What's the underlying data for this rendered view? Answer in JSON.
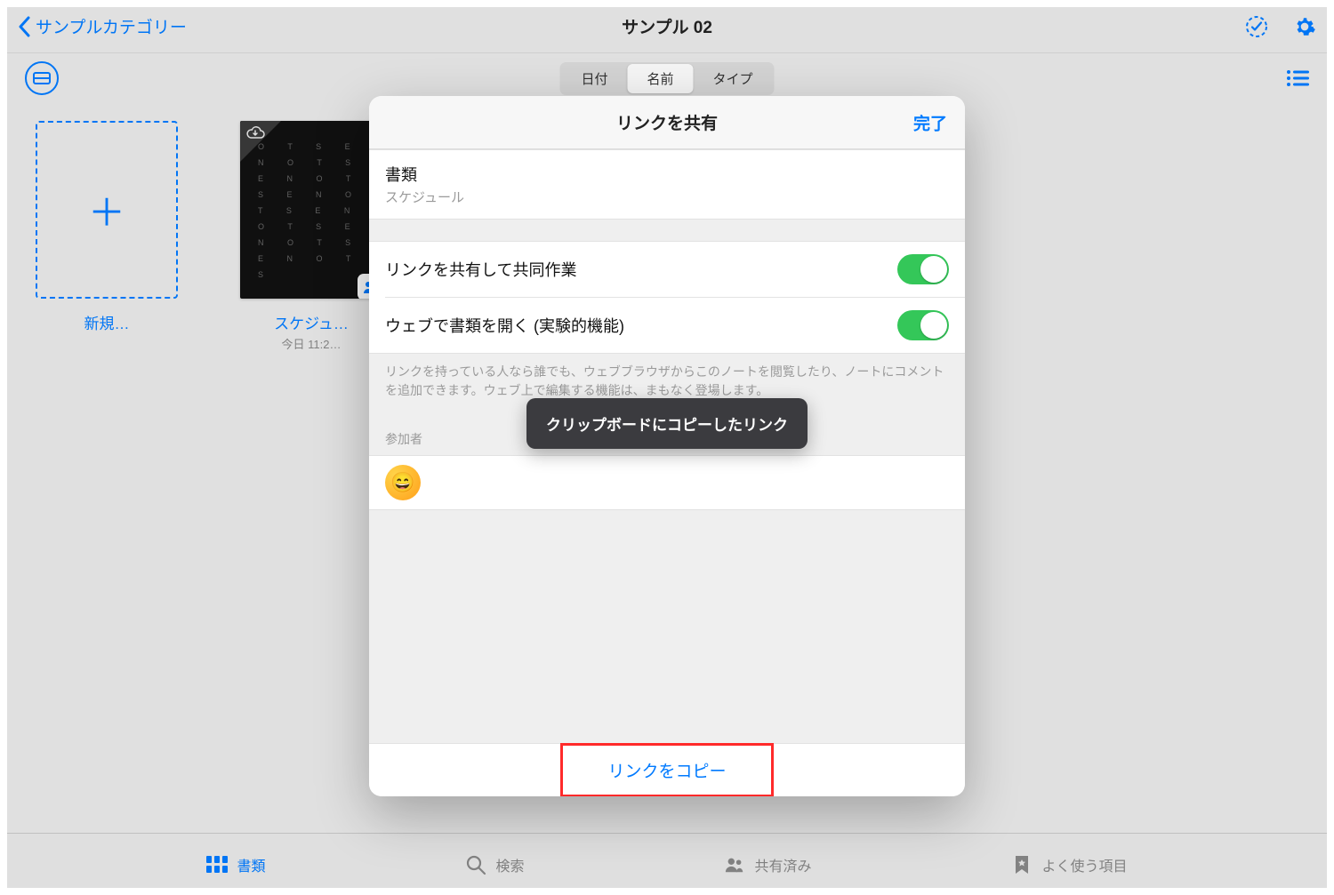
{
  "topbar": {
    "back_label": "サンプルカテゴリー",
    "title": "サンプル 02"
  },
  "segmented": {
    "items": [
      "日付",
      "名前",
      "タイプ"
    ],
    "active_index": 1
  },
  "grid": {
    "new_label": "新規…",
    "doc": {
      "title": "スケジュ…",
      "subtitle": "今日 11:2…",
      "letters": "O T S E N O T S E N O T S E N O T S E N O T S E N O T S E N O T S"
    }
  },
  "tabs": {
    "items": [
      {
        "label": "書類",
        "icon": "grid-icon",
        "active": true
      },
      {
        "label": "検索",
        "icon": "search-icon",
        "active": false
      },
      {
        "label": "共有済み",
        "icon": "people-icon",
        "active": false
      },
      {
        "label": "よく使う項目",
        "icon": "star-icon",
        "active": false
      }
    ]
  },
  "modal": {
    "title": "リンクを共有",
    "done": "完了",
    "doc_heading": "書類",
    "doc_name": "スケジュール",
    "toggle1_label": "リンクを共有して共同作業",
    "toggle2_label": "ウェブで書類を開く (実験的機能)",
    "description": "リンクを持っている人なら誰でも、ウェブブラウザからこのノートを閲覧したり、ノートにコメントを追加できます。ウェブ上で編集する機能は、まもなく登場します。",
    "participants_label": "参加者",
    "participant_emoji": "😄",
    "copy_link": "リンクをコピー"
  },
  "toast": {
    "text": "クリップボードにコピーしたリンク"
  }
}
